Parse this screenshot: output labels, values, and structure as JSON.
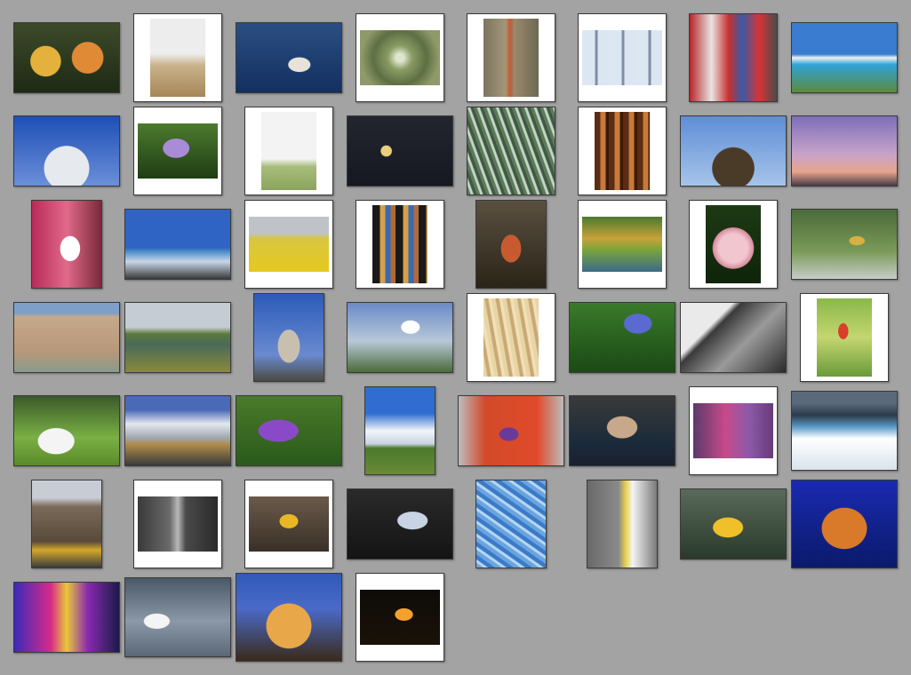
{
  "gallery": {
    "background": "#a3a3a3",
    "thumbnails": [
      {
        "row": 0,
        "bg": "radial-gradient(circle at 30% 55%, #e4b23c 0 18%, transparent 19%), radial-gradient(circle at 70% 50%, #e08a36 0 19%, transparent 20%), linear-gradient(#3d4a2a,#1e2a14)"
      },
      {
        "row": 0,
        "bg": "linear-gradient(#ededed 0 45%, #c9b28a 60%, #a68658 100%)"
      },
      {
        "row": 0,
        "bg": "radial-gradient(ellipse at 60% 60%, #e8e2d8 0 12%, transparent 13%), linear-gradient(#2b4e82,#123060)"
      },
      {
        "row": 0,
        "bg": "radial-gradient(circle at 50% 50%, #dfe6cf 0 8%, #8a9c64 25%, #5d6f43 55%, #8f9a6a 80%)"
      },
      {
        "row": 0,
        "bg": "linear-gradient(90deg,#7b7460,#a39678 40%,#c35a36 48%,#9a8a6c 56%,#6e6854)"
      },
      {
        "row": 0,
        "bg": "repeating-linear-gradient(90deg,#dde7f3 0 14px,#7e8ea8 15px 17px,#dbe6f2 18px 30px)"
      },
      {
        "row": 0,
        "bg": "linear-gradient(90deg,#b8262b,#e8e4e0 25%,#c4302f 45%,#3b5aa8 60%,#d73434 80%,#4a4a4a)"
      },
      {
        "row": 0,
        "bg": "linear-gradient(#3a7cd0 0 45%,#f0f2f4 50%,#2fa3d8 60%,#5c8a3c 100%)"
      },
      {
        "row": 1,
        "bg": "radial-gradient(ellipse at 50% 75%, #e6eaef 0 30%, transparent 31%), linear-gradient(#1e4fb6,#6b8fd8)"
      },
      {
        "row": 1,
        "bg": "radial-gradient(ellipse at 48% 45%, #a98bd8 0 22%, transparent 23%), linear-gradient(#4c7a2e,#1f3d14)"
      },
      {
        "row": 1,
        "bg": "linear-gradient(#f3f3f3 0 60%, #a7bd7b 70%, #8aa55c 100%)"
      },
      {
        "row": 1,
        "bg": "radial-gradient(circle at 37% 50%, #e8d07a 0 7%, transparent 8%), linear-gradient(#23262e,#151820)"
      },
      {
        "row": 1,
        "bg": "repeating-linear-gradient(70deg,#5c7a5a 0 3px,#c5d4c8 4px 6px,#3e5a40 7px 10px)"
      },
      {
        "row": 1,
        "bg": "repeating-linear-gradient(90deg,#5a2c14 0 6px,#c87a38 7px 12px,#3a1a0a 13px 16px)"
      },
      {
        "row": 1,
        "bg": "radial-gradient(ellipse at 50% 75%, #4a3a28 0 28%, transparent 29%), linear-gradient(#5f8ed6,#a6c4ea)"
      },
      {
        "row": 1,
        "bg": "linear-gradient(#7d6fb8,#c7a3c9 55%,#e8a48c 80%,#4a3a4a 100%)"
      },
      {
        "row": 2,
        "bg": "radial-gradient(ellipse at 55% 55%, #ffffff 0 18%, transparent 19%), linear-gradient(90deg,#b82a5a,#e06a8a 50%,#7a2a3a)"
      },
      {
        "row": 2,
        "bg": "linear-gradient(#2f64c4 0 55%, #4a8ac8 60%, #c8d6e8 75%, #3a3a3a 100%)"
      },
      {
        "row": 2,
        "bg": "linear-gradient(#bfc3c8 0 30%, #d8c640 40%, #e6c91e 100%)"
      },
      {
        "row": 2,
        "bg": "repeating-linear-gradient(90deg,#1a1a1a 0 8px,#d6a04a 9px 14px,#3a6ab0 15px 20px,#b06a3a 21px 26px)"
      },
      {
        "row": 2,
        "bg": "radial-gradient(ellipse at 50% 55%, #c85a30 0 20%, transparent 21%), linear-gradient(#5a5040,#2a2418)"
      },
      {
        "row": 2,
        "bg": "linear-gradient(#4a7a2e,#c9a23a 40%,#7aa43a 60%,#3a6a8a 100%)"
      },
      {
        "row": 2,
        "bg": "radial-gradient(circle at 50% 55%, #f1c6cf 0 28%, #d88a9c 40%, transparent 41%), linear-gradient(#1d3a14,#0f240a)"
      },
      {
        "row": 2,
        "bg": "radial-gradient(ellipse at 62% 45%, #d8b040 0 8%, transparent 9%), linear-gradient(#4a6a3a,#7a9a58 60%,#c8ccc8 100%)"
      },
      {
        "row": 3,
        "bg": "linear-gradient(#7ea0c8 0 15%, #c6a88a 20%, #b8987a 70%, #8a9a8a 100%)"
      },
      {
        "row": 3,
        "bg": "linear-gradient(#c6ccd4 0 35%, #5a7a3a 45%, #4a6a5a 60%, #8a8a3a 100%)"
      },
      {
        "row": 3,
        "bg": "radial-gradient(ellipse at 50% 60%, #c8bfae 0 22%, transparent 23%), linear-gradient(#2b5bb8,#6a8ad0 70%,#4a4a40 100%)"
      },
      {
        "row": 3,
        "bg": "radial-gradient(ellipse at 60% 35%, #ffffff 0 10%, transparent 11%), linear-gradient(#6a8ac8,#b8c8d8 55%,#4a6a3a 100%)"
      },
      {
        "row": 3,
        "bg": "repeating-linear-gradient(80deg,#e8d4a4 0 4px,#c8a874 5px 8px,#f0e0b8 9px 12px)"
      },
      {
        "row": 3,
        "bg": "radial-gradient(ellipse at 65% 30%, #5a6ad0 0 14%, transparent 15%), linear-gradient(#3a7a2a,#1a4a14)"
      },
      {
        "row": 3,
        "bg": "linear-gradient(135deg,#eaeaea 0 30%, #3a3a3a 35%, #9a9a9a 60%, #2a2a2a 100%)"
      },
      {
        "row": 3,
        "bg": "radial-gradient(ellipse at 48% 42%, #d8402a 0 12%, transparent 13%), linear-gradient(#8ab84a,#c4d670 50%,#6a9a3a)"
      },
      {
        "row": 4,
        "bg": "radial-gradient(ellipse at 40% 65%, #f4f4f4 0 20%, transparent 21%), linear-gradient(#3a5a2a,#7ab044 60%,#5a8a2a)"
      },
      {
        "row": 4,
        "bg": "linear-gradient(#4a6ab8 0 20%, #e4e8ee 40%, #a0a8b0 60%, #b08a4a 70%, #3a3a3a 100%)"
      },
      {
        "row": 4,
        "bg": "radial-gradient(ellipse at 40% 50%, #8a4ac8 0 22%, transparent 23%), linear-gradient(#4a7a2a,#2a5a1a)"
      },
      {
        "row": 4,
        "bg": "linear-gradient(#2f6ed0 0 30%, #f2f4f8 50%, #c8d4e0 65%, #4a7a2a 70%, #6a8a3a 100%)"
      },
      {
        "row": 4,
        "bg": "radial-gradient(ellipse at 48% 55%, #6a3a9a 0 12%, transparent 13%), linear-gradient(90deg,#bcbcbc,#d24a2a 25%,#e04a2a 75%,#bcbcbc)"
      },
      {
        "row": 4,
        "bg": "radial-gradient(ellipse at 50% 45%, #c8a88a 0 20%, transparent 21%), linear-gradient(#3a3a3a,#1a2a3a 70%,#1a2030)"
      },
      {
        "row": 4,
        "bg": "linear-gradient(90deg,#5a3a6a,#c84a8a 40%,#8a5aa8 70%,#6a3a7a)"
      },
      {
        "row": 4,
        "bg": "linear-gradient(#5a6a7a 0 15%, #2a3a4a 30%, #5a9ac8 45%, #ffffff 60%, #d8e4ec 100%)"
      },
      {
        "row": 5,
        "bg": "linear-gradient(#c8ccd4 0 20%, #7a6a5a 30%, #5a4a3a 70%, #d4a82a 80%, #3a3a3a 100%)"
      },
      {
        "row": 5,
        "bg": "linear-gradient(90deg,#3a3a3a,#6a6a6a 40%,#b8b8b8 50%,#4a4a4a 60%,#2a2a2a)"
      },
      {
        "row": 5,
        "bg": "radial-gradient(ellipse at 50% 45%, #e8b824 0 16%, transparent 17%), linear-gradient(#6a5a4a,#3a3028)"
      },
      {
        "row": 5,
        "bg": "radial-gradient(ellipse at 62% 45%, #c8d4e4 0 16%, transparent 17%), linear-gradient(#2a2a2a,#141414)"
      },
      {
        "row": 5,
        "bg": "repeating-linear-gradient(35deg,#6aa4e0 0 4px,#b8d8f4 5px 7px,#3a7ac8 8px 12px)"
      },
      {
        "row": 5,
        "bg": "linear-gradient(90deg,#6a6a6a,#8a8a8a 45%,#e8d04a 55%,#f4f4f4 65%,#7a7a7a)"
      },
      {
        "row": 5,
        "bg": "radial-gradient(ellipse at 45% 55%, #f0c02a 0 18%, transparent 19%), linear-gradient(#5a6a5a,#2a3a2a)"
      },
      {
        "row": 5,
        "bg": "radial-gradient(ellipse at 50% 55%, #d87a2a 0 30%, transparent 31%), linear-gradient(#1a2ab0,#0a1a6a)"
      },
      {
        "row": 6,
        "bg": "linear-gradient(90deg,#3a2ab8,#d82a8a 35%,#e8c83a 50%,#8a2ab0 70%,#1a1a4a)"
      },
      {
        "row": 6,
        "bg": "radial-gradient(ellipse at 30% 55%, #f4f4f4 0 12%, transparent 13%), linear-gradient(#4a5868,#8a98a8 55%,#5a6878)"
      },
      {
        "row": 6,
        "bg": "radial-gradient(ellipse at 50% 60%, #e8a84a 0 30%, transparent 31%), linear-gradient(#2f5ab8,#4a6ac8 40%,#3a2a1a 100%)"
      },
      {
        "row": 6,
        "bg": "radial-gradient(ellipse at 55% 45%, #f4a02a 0 14%, transparent 15%), linear-gradient(#0e0b08,#1a1208)"
      }
    ]
  }
}
